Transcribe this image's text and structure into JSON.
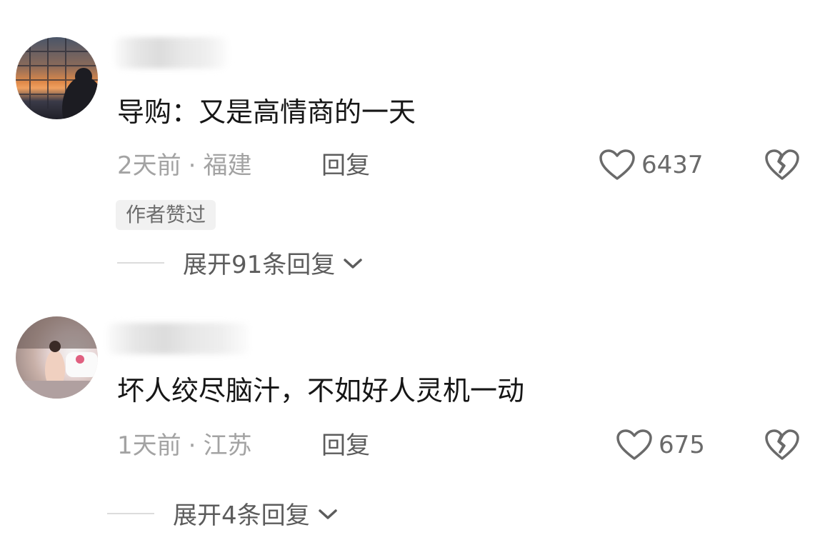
{
  "comments": [
    {
      "text": "导购：又是高情商的一天",
      "time": "2天前",
      "location": "福建",
      "reply_label": "回复",
      "likes": "6437",
      "badge": "作者赞过",
      "expand_label": "展开91条回复"
    },
    {
      "text": "坏人绞尽脑汁，不如好人灵机一动",
      "time": "1天前",
      "location": "江苏",
      "reply_label": "回复",
      "likes": "675",
      "expand_label": "展开4条回复"
    }
  ],
  "separator": "·",
  "icons": {
    "like": "heart-outline-icon",
    "dislike": "broken-heart-icon",
    "expand": "chevron-down-icon"
  },
  "colors": {
    "text": "#161616",
    "meta": "#a3a3a3",
    "secondary": "#5c5c5c",
    "badge_bg": "#f1f1f1"
  }
}
